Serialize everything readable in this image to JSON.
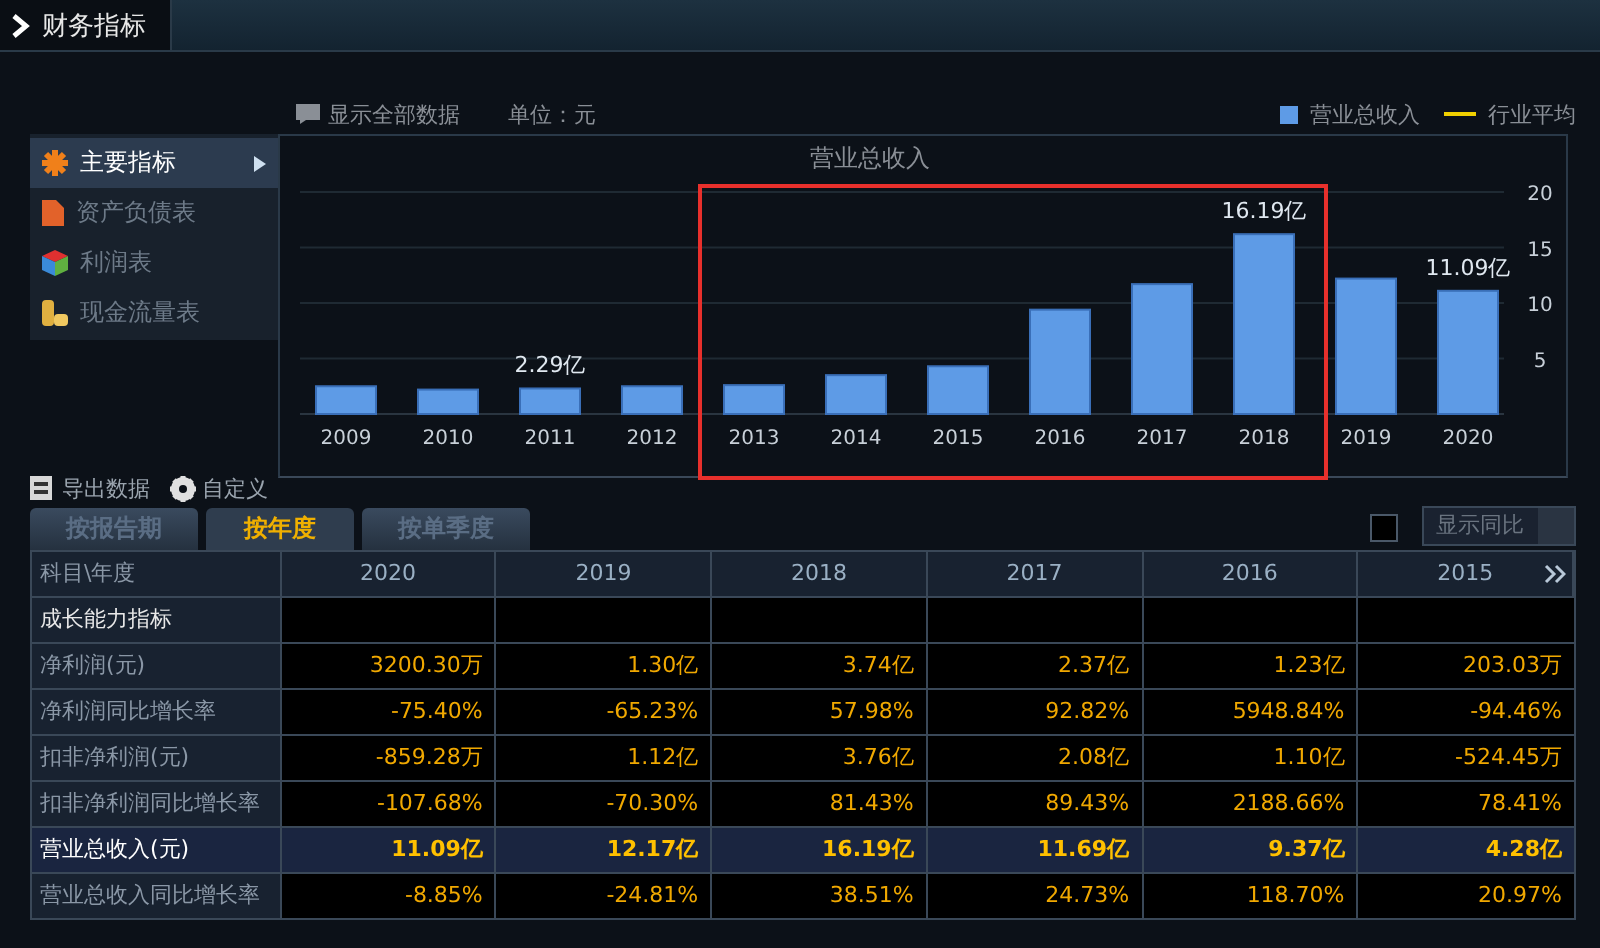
{
  "panel": {
    "title": "财务指标"
  },
  "toolbar": {
    "show_all": "显示全部数据",
    "unit": "单位：元"
  },
  "sidebar": {
    "items": [
      {
        "label": "主要指标",
        "selected": true
      },
      {
        "label": "资产负债表",
        "selected": false
      },
      {
        "label": "利润表",
        "selected": false
      },
      {
        "label": "现金流量表",
        "selected": false
      }
    ]
  },
  "chart": {
    "chart_data": {
      "type": "bar",
      "title": "营业总收入",
      "categories": [
        "2009",
        "2010",
        "2011",
        "2012",
        "2013",
        "2014",
        "2015",
        "2016",
        "2017",
        "2018",
        "2019",
        "2020"
      ],
      "series": [
        {
          "name": "营业总收入",
          "color": "#5e9be6",
          "values": [
            2.5,
            2.2,
            2.3,
            2.5,
            2.6,
            3.5,
            4.3,
            9.4,
            11.7,
            16.2,
            12.2,
            11.1
          ]
        },
        {
          "name": "行业平均",
          "color": "#f0d000",
          "values": [
            null,
            null,
            null,
            null,
            null,
            null,
            null,
            null,
            null,
            null,
            null,
            null
          ]
        }
      ],
      "ylim": [
        0,
        20
      ],
      "yticks": [
        5,
        10,
        15,
        20
      ],
      "grid": true,
      "value_labels": [
        null,
        null,
        "2.29亿",
        null,
        null,
        null,
        null,
        null,
        null,
        "16.19亿",
        null,
        "11.09亿"
      ]
    }
  },
  "actions": [
    {
      "label": "导出数据"
    },
    {
      "label": "自定义"
    }
  ],
  "tabs": [
    {
      "label": "按报告期",
      "selected": false
    },
    {
      "label": "按年度",
      "selected": true
    },
    {
      "label": "按单季度",
      "selected": false
    }
  ],
  "compare": {
    "checked": false,
    "label": "显示同比"
  },
  "table": {
    "columns": [
      "科目\\年度",
      "2020",
      "2019",
      "2018",
      "2017",
      "2016",
      "2015"
    ],
    "rows": [
      {
        "kind": "section",
        "label": "成长能力指标",
        "cells": [
          "",
          "",
          "",
          "",
          "",
          ""
        ]
      },
      {
        "kind": "data",
        "label": "净利润(元)",
        "cells": [
          "3200.30万",
          "1.30亿",
          "3.74亿",
          "2.37亿",
          "1.23亿",
          "203.03万"
        ]
      },
      {
        "kind": "data",
        "label": "净利润同比增长率",
        "cells": [
          "-75.40%",
          "-65.23%",
          "57.98%",
          "92.82%",
          "5948.84%",
          "-94.46%"
        ]
      },
      {
        "kind": "data",
        "label": "扣非净利润(元)",
        "cells": [
          "-859.28万",
          "1.12亿",
          "3.76亿",
          "2.08亿",
          "1.10亿",
          "-524.45万"
        ]
      },
      {
        "kind": "data",
        "label": "扣非净利润同比增长率",
        "cells": [
          "-107.68%",
          "-70.30%",
          "81.43%",
          "89.43%",
          "2188.66%",
          "78.41%"
        ]
      },
      {
        "kind": "highlight",
        "label": "营业总收入(元)",
        "cells": [
          "11.09亿",
          "12.17亿",
          "16.19亿",
          "11.69亿",
          "9.37亿",
          "4.28亿"
        ]
      },
      {
        "kind": "data",
        "label": "营业总收入同比增长率",
        "cells": [
          "-8.85%",
          "-24.81%",
          "38.51%",
          "24.73%",
          "118.70%",
          "20.97%"
        ]
      }
    ]
  }
}
